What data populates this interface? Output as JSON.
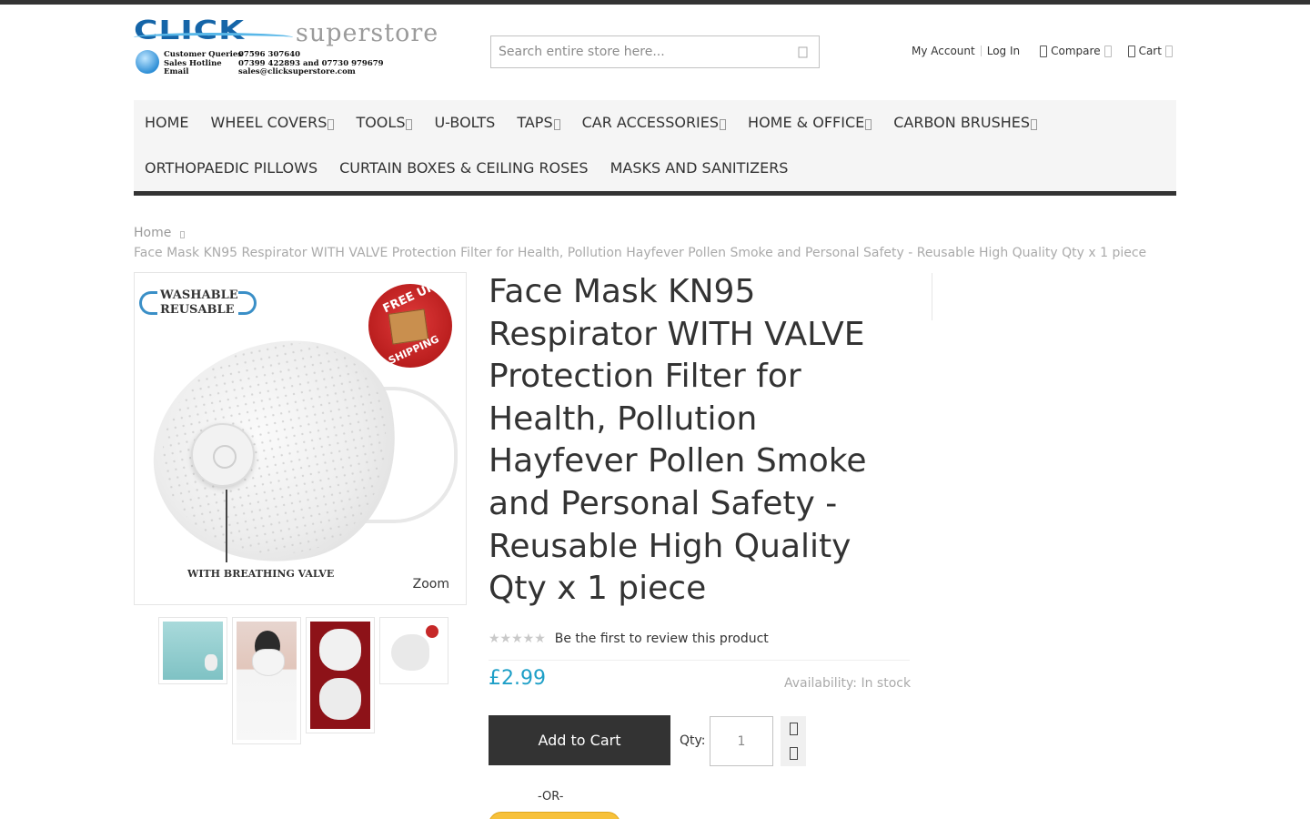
{
  "header": {
    "logo": {
      "word_main": "CLICK",
      "word_sub": "superstore",
      "info": [
        {
          "label": "Customer Queries",
          "value": "07596 307640"
        },
        {
          "label": "Sales Hotline",
          "value": "07399 422893 and 07730 979679"
        },
        {
          "label": "Email",
          "value": "sales@clicksuperstore.com"
        }
      ]
    },
    "search": {
      "placeholder": "Search entire store here...",
      "button_icon": "search-icon"
    },
    "links": {
      "my_account": "My Account",
      "log_in": "Log In",
      "compare": "Compare",
      "cart": "Cart"
    }
  },
  "nav": {
    "row1": [
      {
        "label": "HOME",
        "has_submenu": false
      },
      {
        "label": "WHEEL COVERS",
        "has_submenu": true
      },
      {
        "label": "TOOLS",
        "has_submenu": true
      },
      {
        "label": "U-BOLTS",
        "has_submenu": false
      },
      {
        "label": "TAPS",
        "has_submenu": true
      },
      {
        "label": "CAR ACCESSORIES",
        "has_submenu": true
      },
      {
        "label": "HOME & OFFICE",
        "has_submenu": true
      },
      {
        "label": "CARBON BRUSHES",
        "has_submenu": true
      }
    ],
    "row2": [
      {
        "label": "ORTHOPAEDIC PILLOWS"
      },
      {
        "label": "CURTAIN BOXES & CEILING ROSES"
      },
      {
        "label": "MASKS AND SANITIZERS"
      }
    ]
  },
  "breadcrumb": {
    "home": "Home",
    "current": "Face Mask KN95 Respirator WITH VALVE Protection Filter for Health, Pollution Hayfever Pollen Smoke and Personal Safety - Reusable High Quality Qty x 1 piece"
  },
  "gallery": {
    "image_text": {
      "washable": "WASHABLE",
      "reusable": "REUSABLE",
      "badge_top": "FREE UK",
      "badge_bottom": "SHIPPING",
      "caption": "WITH BREATHING VALVE"
    },
    "zoom_label": "Zoom"
  },
  "product": {
    "title": "Face Mask KN95 Respirator WITH VALVE Protection Filter for Health, Pollution Hayfever Pollen Smoke and Personal Safety - Reusable High Quality Qty x 1 piece",
    "rating_stars": "★★★★★",
    "rating_value": 0,
    "review_link": "Be the first to review this product",
    "price": "£2.99",
    "availability": "Availability: In stock",
    "add_to_cart": "Add to Cart",
    "qty_label": "Qty:",
    "qty_value": "1",
    "or_label": "-OR-"
  },
  "colors": {
    "accent_price": "#1e9fc7",
    "button_dark": "#333333",
    "nav_bg": "#f5f5f5"
  }
}
